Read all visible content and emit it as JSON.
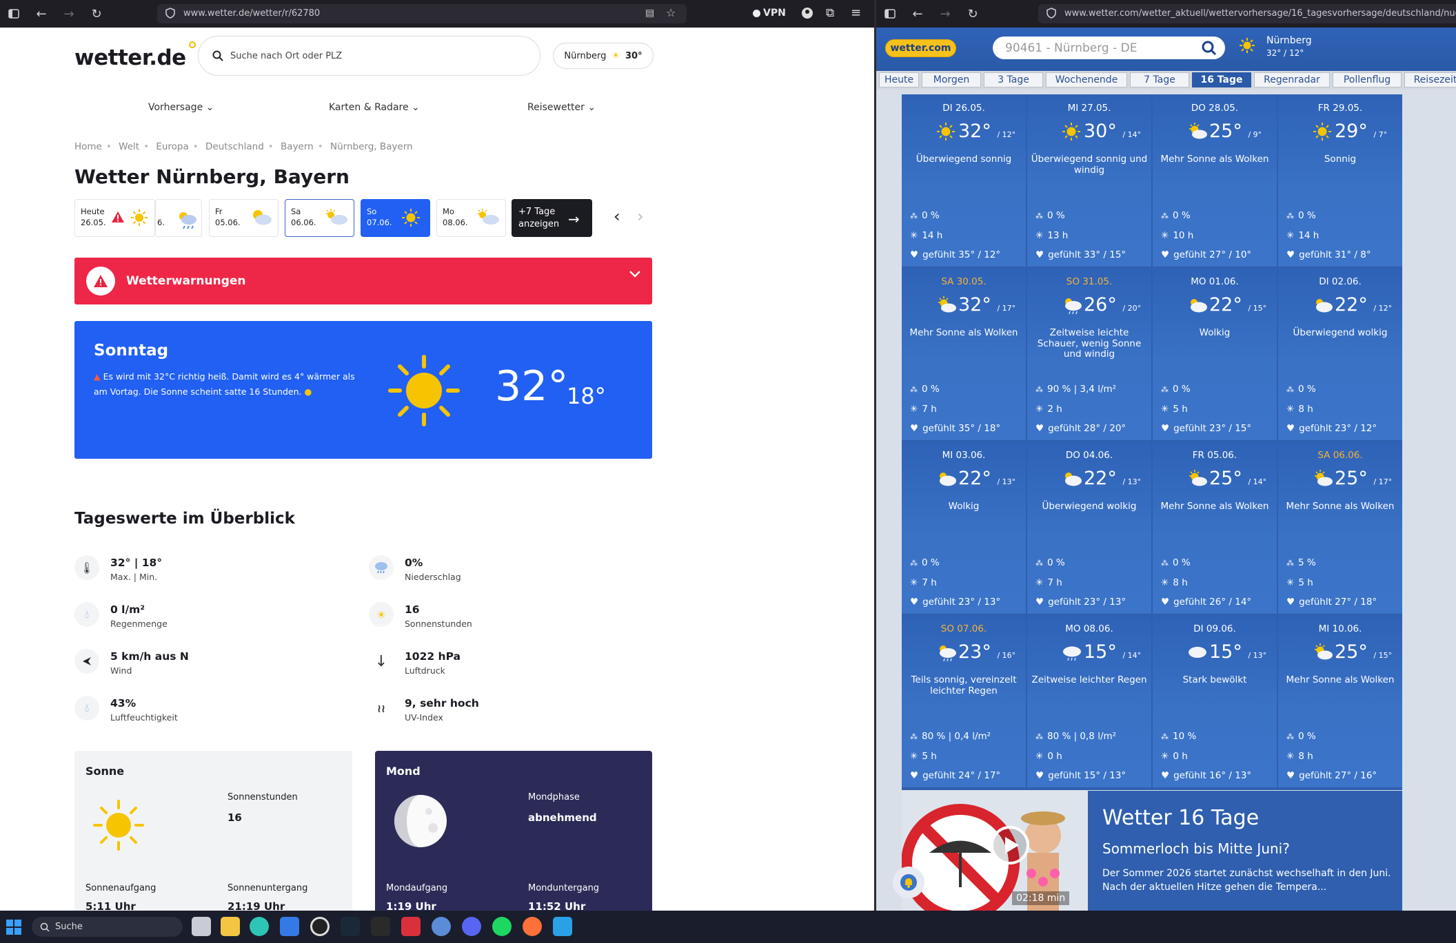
{
  "left": {
    "url": "www.wetter.de/wetter/r/62780",
    "vpn": "VPN",
    "logo": "wetter.de",
    "search_placeholder": "Suche nach Ort oder PLZ",
    "location_pill": {
      "city": "Nürnberg",
      "temp": "30°"
    },
    "nav": [
      "Vorhersage",
      "Karten & Radare",
      "Reisewetter"
    ],
    "breadcrumb": [
      "Home",
      "Welt",
      "Europa",
      "Deutschland",
      "Bayern",
      "Nürnberg, Bayern"
    ],
    "title": "Wetter Nürnberg, Bayern",
    "days": [
      {
        "name": "Heute",
        "date": "26.05."
      },
      {
        "name": "",
        "date": "6."
      },
      {
        "name": "Fr",
        "date": "05.06."
      },
      {
        "name": "Sa",
        "date": "06.06."
      },
      {
        "name": "So",
        "date": "07.06."
      },
      {
        "name": "Mo",
        "date": "08.06."
      }
    ],
    "more_days": [
      "+7 Tage",
      "anzeigen"
    ],
    "warning": "Wetterwarnungen",
    "hero": {
      "day": "Sonntag",
      "text1": "Es wird mit 32°C richtig heiß. Damit wird es 4° wärmer als",
      "text2": "am Vortag. Die Sonne scheint satte 16 Stunden.",
      "max": "32°",
      "min": "18°"
    },
    "overview_title": "Tageswerte im Überblick",
    "overview": [
      {
        "value": "32° | 18°",
        "label": "Max. | Min."
      },
      {
        "value": "0%",
        "label": "Niederschlag"
      },
      {
        "value": "0 l/m²",
        "label": "Regenmenge"
      },
      {
        "value": "16",
        "label": "Sonnenstunden"
      },
      {
        "value": "5 km/h aus N",
        "label": "Wind"
      },
      {
        "value": "1022 hPa",
        "label": "Luftdruck"
      },
      {
        "value": "43%",
        "label": "Luftfeuchtigkeit"
      },
      {
        "value": "9, sehr hoch",
        "label": "UV-Index"
      }
    ],
    "sun_card": {
      "title": "Sonne",
      "hours_label": "Sonnenstunden",
      "hours": "16",
      "rise_label": "Sonnenaufgang",
      "rise": "5:11 Uhr",
      "set_label": "Sonnenuntergang",
      "set": "21:19 Uhr"
    },
    "moon_card": {
      "title": "Mond",
      "phase_label": "Mondphase",
      "phase": "abnehmend",
      "rise_label": "Mondaufgang",
      "rise": "1:19 Uhr",
      "set_label": "Monduntergang",
      "set": "11:52 Uhr"
    }
  },
  "right": {
    "url": "www.wetter.com/wetter_aktuell/wettervorhersage/16_tagesvorhersage/deutschland/nuernbe",
    "logo": "wetter.com",
    "search_value": "90461 - Nürnberg - DE",
    "loc_city": "Nürnberg",
    "loc_temp": "32° / 12°",
    "tabs": [
      "Heute",
      "Morgen",
      "3 Tage",
      "Wochenende",
      "7 Tage",
      "16 Tage",
      "Regenradar",
      "Pollenflug",
      "Reisezeit"
    ],
    "active_tab": "16 Tage",
    "forecast": [
      {
        "date": "DI 26.05.",
        "we": false,
        "max": "32°",
        "min": "/ 12°",
        "desc": "Überwiegend sonnig",
        "rain": "0 %",
        "sun": "14 h",
        "feel": "gefühlt 35° / 12°",
        "icon": "sun"
      },
      {
        "date": "MI 27.05.",
        "we": false,
        "max": "30°",
        "min": "/ 14°",
        "desc": "Überwiegend sonnig und windig",
        "rain": "0 %",
        "sun": "13 h",
        "feel": "gefühlt 33° / 15°",
        "icon": "sun"
      },
      {
        "date": "DO 28.05.",
        "we": false,
        "max": "25°",
        "min": "/ 9°",
        "desc": "Mehr Sonne als Wolken",
        "rain": "0 %",
        "sun": "10 h",
        "feel": "gefühlt 27° / 10°",
        "icon": "suncloud"
      },
      {
        "date": "FR 29.05.",
        "we": false,
        "max": "29°",
        "min": "/ 7°",
        "desc": "Sonnig",
        "rain": "0 %",
        "sun": "14 h",
        "feel": "gefühlt 31° / 8°",
        "icon": "sun"
      },
      {
        "date": "SA 30.05.",
        "we": true,
        "max": "32°",
        "min": "/ 17°",
        "desc": "Mehr Sonne als Wolken",
        "rain": "0 %",
        "sun": "7 h",
        "feel": "gefühlt 35° / 18°",
        "icon": "suncloud"
      },
      {
        "date": "SO 31.05.",
        "we": true,
        "max": "26°",
        "min": "/ 20°",
        "desc": "Zeitweise leichte Schauer, wenig Sonne und windig",
        "rain": "90 % | 3,4 l/m²",
        "sun": "2 h",
        "feel": "gefühlt 28° / 20°",
        "icon": "suncloudrain"
      },
      {
        "date": "MO 01.06.",
        "we": false,
        "max": "22°",
        "min": "/ 15°",
        "desc": "Wolkig",
        "rain": "0 %",
        "sun": "5 h",
        "feel": "gefühlt 23° / 15°",
        "icon": "cloudsun"
      },
      {
        "date": "DI 02.06.",
        "we": false,
        "max": "22°",
        "min": "/ 12°",
        "desc": "Überwiegend wolkig",
        "rain": "0 %",
        "sun": "8 h",
        "feel": "gefühlt 23° / 12°",
        "icon": "cloudsun"
      },
      {
        "date": "MI 03.06.",
        "we": false,
        "max": "22°",
        "min": "/ 13°",
        "desc": "Wolkig",
        "rain": "0 %",
        "sun": "7 h",
        "feel": "gefühlt 23° / 13°",
        "icon": "cloudsun"
      },
      {
        "date": "DO 04.06.",
        "we": false,
        "max": "22°",
        "min": "/ 13°",
        "desc": "Überwiegend wolkig",
        "rain": "0 %",
        "sun": "7 h",
        "feel": "gefühlt 23° / 13°",
        "icon": "cloudsun"
      },
      {
        "date": "FR 05.06.",
        "we": false,
        "max": "25°",
        "min": "/ 14°",
        "desc": "Mehr Sonne als Wolken",
        "rain": "0 %",
        "sun": "8 h",
        "feel": "gefühlt 26° / 14°",
        "icon": "suncloud"
      },
      {
        "date": "SA 06.06.",
        "we": true,
        "max": "25°",
        "min": "/ 17°",
        "desc": "Mehr Sonne als Wolken",
        "rain": "5 %",
        "sun": "5 h",
        "feel": "gefühlt 27° / 18°",
        "icon": "suncloud"
      },
      {
        "date": "SO 07.06.",
        "we": true,
        "max": "23°",
        "min": "/ 16°",
        "desc": "Teils sonnig, vereinzelt leichter Regen",
        "rain": "80 % | 0,4 l/m²",
        "sun": "5 h",
        "feel": "gefühlt 24° / 17°",
        "icon": "suncloudrain"
      },
      {
        "date": "MO 08.06.",
        "we": false,
        "max": "15°",
        "min": "/ 14°",
        "desc": "Zeitweise leichter Regen",
        "rain": "80 % | 0,8 l/m²",
        "sun": "0 h",
        "feel": "gefühlt 15° / 13°",
        "icon": "cloudrain"
      },
      {
        "date": "DI 09.06.",
        "we": false,
        "max": "15°",
        "min": "/ 13°",
        "desc": "Stark bewölkt",
        "rain": "10 %",
        "sun": "0 h",
        "feel": "gefühlt 16° / 13°",
        "icon": "cloud"
      },
      {
        "date": "MI 10.06.",
        "we": false,
        "max": "25°",
        "min": "/ 15°",
        "desc": "Mehr Sonne als Wolken",
        "rain": "0 %",
        "sun": "8 h",
        "feel": "gefühlt 27° / 16°",
        "icon": "suncloud"
      }
    ],
    "ad": {
      "title": "Wetter 16 Tage",
      "subtitle": "Sommerloch bis Mitte Juni?",
      "text1": "Der Sommer 2026 startet zunächst wechselhaft in den Juni.",
      "text2": "Nach der aktuellen Hitze gehen die Tempera...",
      "duration": "02:18 min"
    }
  },
  "taskbar": {
    "search": "Suche"
  }
}
